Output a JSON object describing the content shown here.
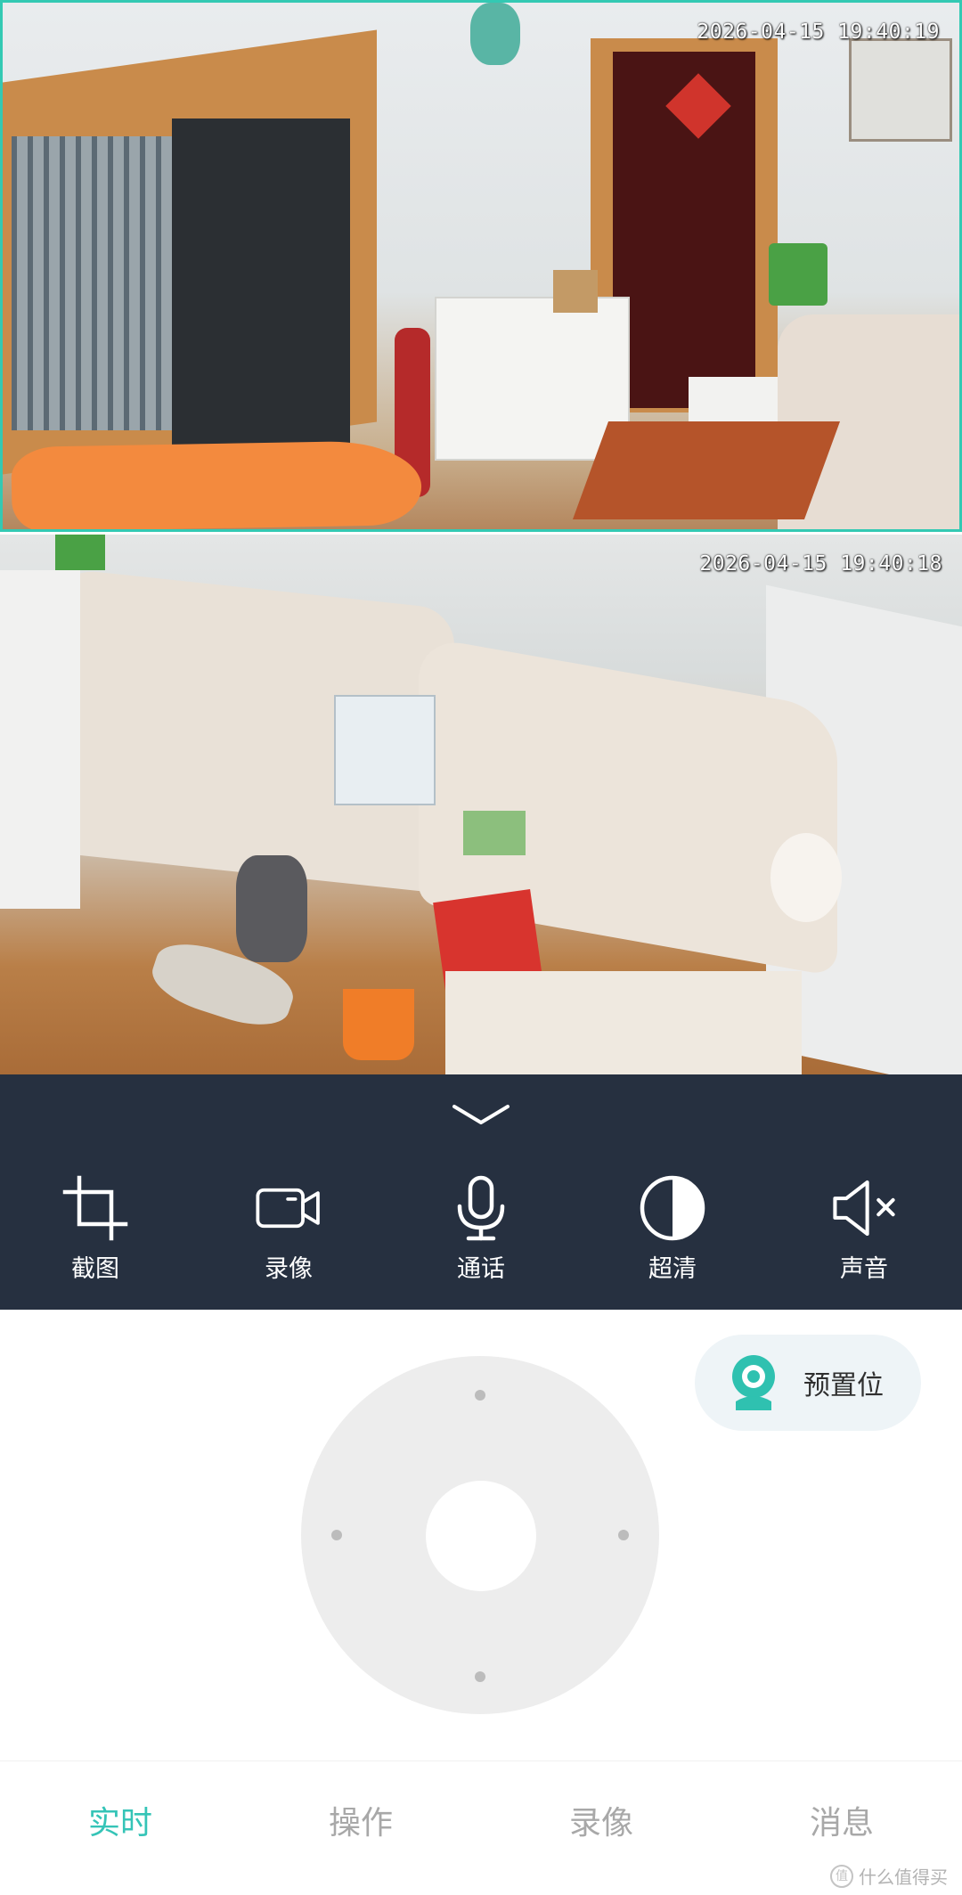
{
  "feeds": [
    {
      "timestamp": "2026-04-15 19:40:19"
    },
    {
      "timestamp": "2026-04-15 19:40:18"
    }
  ],
  "controls": {
    "screenshot_label": "截图",
    "record_label": "录像",
    "talk_label": "通话",
    "quality_label": "超清",
    "sound_label": "声音"
  },
  "preset": {
    "label": "预置位"
  },
  "nav": {
    "items": [
      {
        "label": "实时"
      },
      {
        "label": "操作"
      },
      {
        "label": "录像"
      },
      {
        "label": "消息"
      }
    ],
    "active": "实时"
  },
  "watermark": {
    "text": "什么值得买",
    "badge": "值"
  },
  "colors": {
    "accent": "#35c4b7",
    "control_bar": "#263040",
    "redaction": "#f38a3e",
    "feed_border": "#33c9b3"
  }
}
